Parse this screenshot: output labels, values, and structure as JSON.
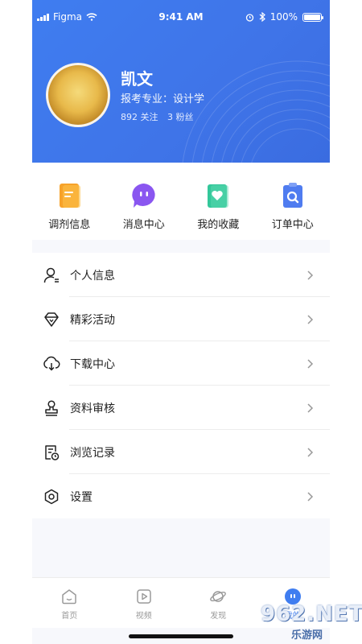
{
  "status_bar": {
    "carrier": "Figma",
    "time": "9:41 AM",
    "battery": "100%"
  },
  "profile": {
    "name": "凯文",
    "major": "报考专业：设计学",
    "following": "892 关注",
    "followers": "3 粉丝"
  },
  "quick_actions": [
    {
      "label": "调剂信息",
      "icon": "document-icon",
      "color": "#f7a22a"
    },
    {
      "label": "消息中心",
      "icon": "message-icon",
      "color": "#8a56f0"
    },
    {
      "label": "我的收藏",
      "icon": "favorite-icon",
      "color": "#33c79a"
    },
    {
      "label": "订单中心",
      "icon": "order-search-icon",
      "color": "#4f7cf0"
    }
  ],
  "menu": [
    {
      "label": "个人信息",
      "icon": "user-icon"
    },
    {
      "label": "精彩活动",
      "icon": "diamond-icon"
    },
    {
      "label": "下载中心",
      "icon": "download-icon"
    },
    {
      "label": "资料审核",
      "icon": "stamp-icon"
    },
    {
      "label": "浏览记录",
      "icon": "history-icon"
    },
    {
      "label": "设置",
      "icon": "settings-icon"
    }
  ],
  "tabs": [
    {
      "label": "首页",
      "icon": "home-icon"
    },
    {
      "label": "视频",
      "icon": "video-icon"
    },
    {
      "label": "发现",
      "icon": "planet-icon"
    },
    {
      "label": "我的",
      "icon": "profile-tab-icon",
      "active_color": "#3f7df0"
    }
  ],
  "watermark": {
    "main": "962.NET",
    "sub": "乐游网"
  }
}
